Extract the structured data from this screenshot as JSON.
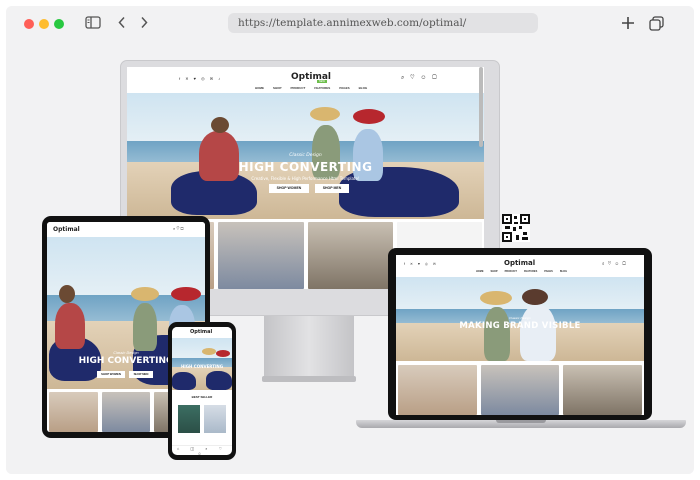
{
  "browser": {
    "url": "https://template.annimexweb.com/optimal/"
  },
  "site": {
    "logo": "Optimal",
    "nav": [
      "HOME",
      "SHOP",
      "PRODUCT",
      "FEATURES",
      "PAGES",
      "BLOG"
    ],
    "nav_badge": "NEW",
    "desktop_hero": {
      "kicker": "Classic Design",
      "title": "HIGH CONVERTING",
      "subtitle": "Creative, Flexible & High Performance Html Template!",
      "buttons": [
        "SHOP WOMEN",
        "SHOP MEN"
      ]
    },
    "tablet_hero": {
      "kicker": "Classic Design",
      "title": "HIGH CONVERTING",
      "buttons": [
        "SHOP WOMEN",
        "SHOP MEN"
      ]
    },
    "laptop_hero": {
      "kicker": "Classic Design",
      "title": "MAKING BRAND VISIBLE"
    },
    "phone_section": "BEST SELLER"
  }
}
